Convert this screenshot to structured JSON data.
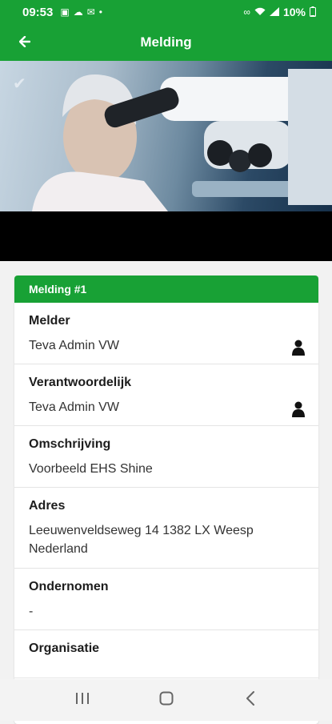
{
  "status_bar": {
    "time": "09:53",
    "left_icons": [
      "image-icon",
      "cloud-icon",
      "mail-icon",
      "dot-icon"
    ],
    "right_icons": [
      "link-icon",
      "wifi-icon",
      "signal-icon"
    ],
    "battery": "10%"
  },
  "app_bar": {
    "title": "Melding",
    "back_icon": "back-arrow-icon"
  },
  "hero": {
    "check_icon": "check-icon"
  },
  "card": {
    "header": "Melding #1",
    "fields": [
      {
        "label": "Melder",
        "value": "Teva Admin VW",
        "icon": "person-icon"
      },
      {
        "label": "Verantwoordelijk",
        "value": "Teva Admin VW",
        "icon": "person-icon"
      },
      {
        "label": "Omschrijving",
        "value": "Voorbeeld EHS Shine"
      },
      {
        "label": "Adres",
        "value": "Leeuwenveldseweg 14 1382 LX Weesp Nederland"
      },
      {
        "label": "Ondernomen",
        "value": "-"
      },
      {
        "label": "Organisatie",
        "value": ""
      }
    ]
  },
  "nav_bar": [
    "recents-icon",
    "home-icon",
    "back-icon"
  ],
  "colors": {
    "primary": "#18a135",
    "background": "#f2f2f2"
  }
}
